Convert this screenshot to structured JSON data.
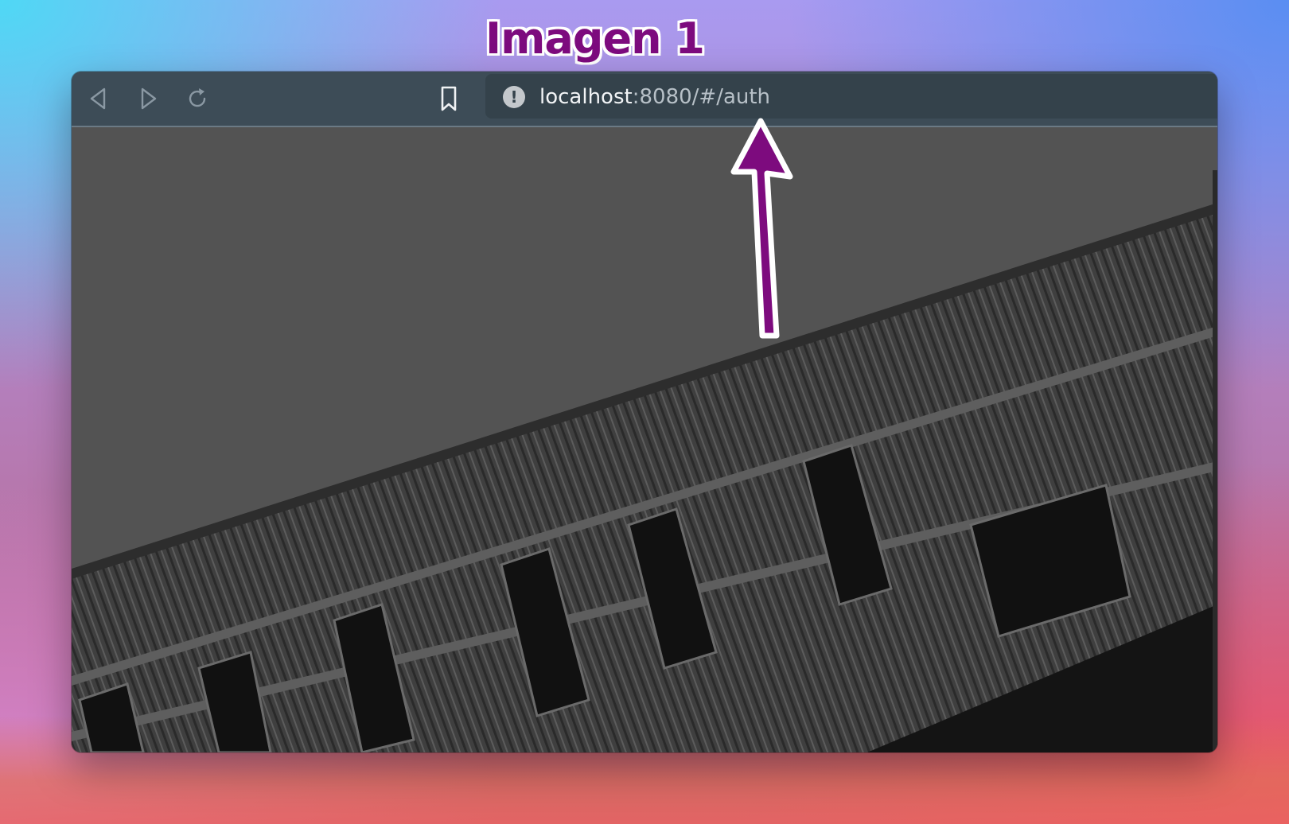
{
  "caption": "Imagen 1",
  "browser": {
    "url_host": "localhost",
    "url_rest": ":8080/#/auth"
  },
  "icons": {
    "back": "back-arrow-icon",
    "forward": "forward-arrow-icon",
    "reload": "reload-icon",
    "bookmark": "bookmark-icon",
    "info": "info-icon"
  },
  "page": {
    "background_image": "grayscale photograph of a building facade with vertical metal slats and windows, shot diagonally"
  },
  "annotation": {
    "arrow_color": "#7d0b7e"
  },
  "colors": {
    "toolbar": "#3d4c57",
    "urlbar": "#34424b",
    "caption": "#7d0b7e"
  }
}
